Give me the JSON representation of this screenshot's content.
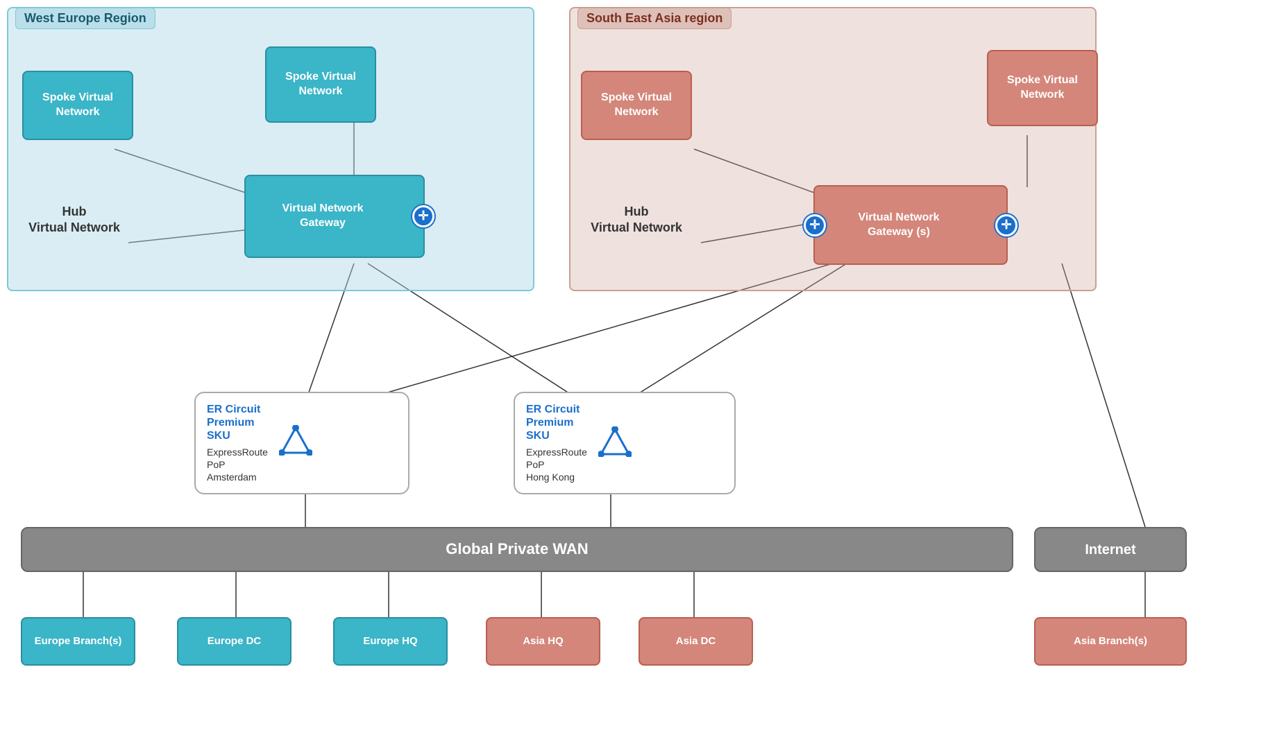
{
  "regions": {
    "west": {
      "label": "West Europe Region",
      "spoke1": "Spoke Virtual\nNetwork",
      "spoke2": "Spoke Virtual\nNetwork",
      "hub": "Hub\nVirtual Network",
      "gateway": "Virtual Network\nGateway"
    },
    "sea": {
      "label": "South East Asia region",
      "spoke1": "Spoke Virtual\nNetwork",
      "spoke2": "Spoke Virtual\nNetwork",
      "hub": "Hub\nVirtual Network",
      "gateway": "Virtual Network\nGateway (s)"
    }
  },
  "er_circuits": {
    "amsterdam": {
      "circuit_label": "ER Circuit\nPremium\nSKU",
      "pop_label": "ExpressRoute\nPoP\nAmsterdam"
    },
    "hongkong": {
      "circuit_label": "ER Circuit\nPremium\nSKU",
      "pop_label": "ExpressRoute\nPoP\nHong Kong"
    }
  },
  "wan": {
    "label": "Global Private WAN"
  },
  "internet": {
    "label": "Internet"
  },
  "branches": {
    "europe_branches": "Europe Branch(s)",
    "europe_dc": "Europe DC",
    "europe_hq": "Europe HQ",
    "asia_hq": "Asia HQ",
    "asia_dc": "Asia DC",
    "asia_branches": "Asia Branch(s)"
  }
}
